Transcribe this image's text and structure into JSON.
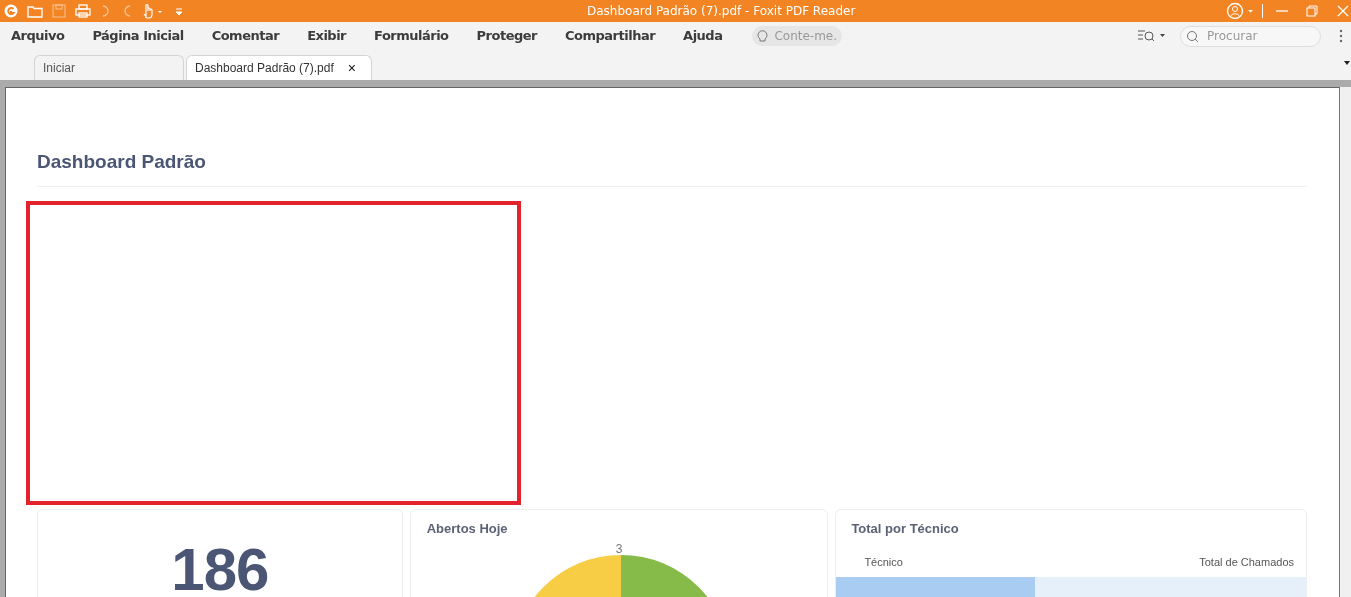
{
  "window": {
    "title": "Dashboard Padrão (7).pdf - Foxit PDF Reader"
  },
  "menu": [
    {
      "label": "Arquivo"
    },
    {
      "label": "Página Inicial"
    },
    {
      "label": "Comentar"
    },
    {
      "label": "Exibir"
    },
    {
      "label": "Formulário"
    },
    {
      "label": "Proteger"
    },
    {
      "label": "Compartilhar"
    },
    {
      "label": "Ajuda"
    }
  ],
  "tell_me": {
    "placeholder": "Conte-me."
  },
  "search": {
    "placeholder": "Procurar"
  },
  "tabs": [
    {
      "label": "Iniciar",
      "selected": false
    },
    {
      "label": "Dashboard Padrão (7).pdf",
      "selected": true,
      "close_label": "×"
    }
  ],
  "document": {
    "title": "Dashboard Padrão",
    "total_card": {
      "value": "186"
    },
    "opened_today": {
      "title": "Abertos Hoje",
      "top_label": "3"
    },
    "by_technician": {
      "title": "Total por Técnico",
      "columns": [
        "Técnico",
        "Total de Chamados"
      ]
    }
  }
}
